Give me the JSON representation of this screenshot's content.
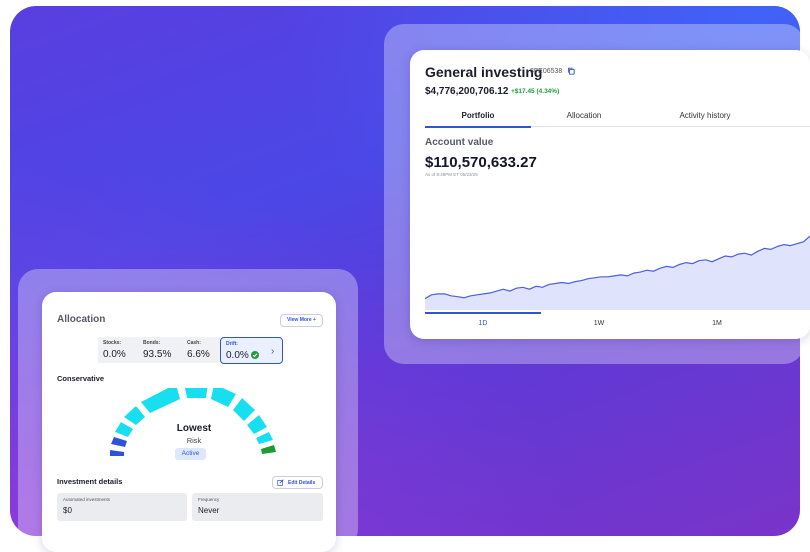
{
  "account": {
    "title": "General investing",
    "id": "3FE06538",
    "balance": "$4,776,200,706.12",
    "change": "+$17.45 (4.34%)",
    "tabs": [
      "Portfolio",
      "Allocation",
      "Activity history"
    ],
    "active_tab": "Portfolio",
    "account_value_label": "Account value",
    "account_value": "$110,570,633.27",
    "as_of": "As of 8:49PM ET 05/23/25",
    "ranges": [
      "1D",
      "1W",
      "1M"
    ],
    "active_range": "1D"
  },
  "chart_data": {
    "type": "area",
    "x": [
      0,
      1,
      2,
      3,
      4,
      5,
      6,
      7,
      8,
      9,
      10,
      11,
      12,
      13,
      14,
      15,
      16,
      17,
      18,
      19,
      20,
      21,
      22,
      23,
      24,
      25,
      26,
      27,
      28,
      29,
      30,
      31,
      32,
      33,
      34,
      35,
      36,
      37,
      38,
      39,
      40,
      41,
      42,
      43,
      44,
      45,
      46,
      47,
      48,
      49,
      50,
      51,
      52,
      53,
      54,
      55,
      56,
      57,
      58,
      59
    ],
    "values": [
      12,
      16,
      17,
      17,
      15,
      14,
      13,
      15,
      16,
      17,
      18,
      20,
      22,
      20,
      23,
      24,
      22,
      25,
      24,
      27,
      28,
      29,
      28,
      30,
      31,
      33,
      34,
      35,
      35,
      36,
      37,
      36,
      39,
      40,
      42,
      41,
      44,
      46,
      45,
      48,
      50,
      49,
      52,
      53,
      51,
      54,
      57,
      56,
      59,
      60,
      58,
      62,
      65,
      64,
      67,
      69,
      68,
      70,
      72,
      78
    ],
    "title": "",
    "xlabel": "",
    "ylabel": "",
    "color": "#4d5ee0",
    "fill": "#dfe3fb"
  },
  "allocation": {
    "title": "Allocation",
    "view_more": "View More +",
    "stats": [
      {
        "label": "Stocks:",
        "value": "0.0%"
      },
      {
        "label": "Bonds:",
        "value": "93.5%"
      },
      {
        "label": "Cash:",
        "value": "6.6%"
      }
    ],
    "drift": {
      "label": "Drift:",
      "value": "0.0%"
    },
    "risk_profile": "Conservative",
    "risk_level": "Lowest",
    "risk_word": "Risk",
    "status": "Active",
    "colors": {
      "accent": "#2f55d4",
      "gauge_cyan": "#18dff0",
      "gauge_blue": "#2d53d9",
      "gauge_green": "#1c9b2e"
    }
  },
  "investment": {
    "title": "Investment details",
    "edit_label": "Edit Details",
    "fields": [
      {
        "label": "Automated investments",
        "value": "$0"
      },
      {
        "label": "Frequency",
        "value": "Never"
      }
    ]
  }
}
